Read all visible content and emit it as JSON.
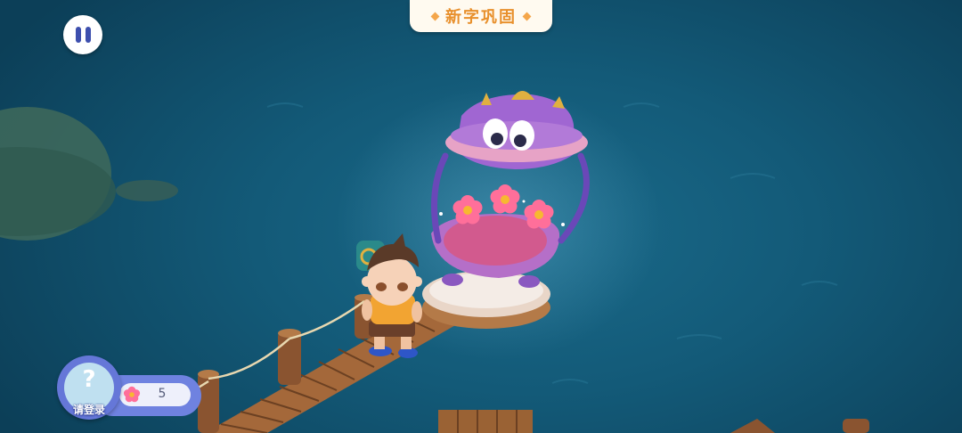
{
  "game": {
    "title": "新字巩固",
    "pause_icon": "pause-icon"
  },
  "hud": {
    "login_label": "请登录",
    "avatar_icon": "question-mark-icon",
    "currency_icon": "flower-icon",
    "flower_count": "5"
  },
  "colors": {
    "title": "#e8902c",
    "hud_accent": "#6f82e0",
    "flower": "#ff6f9a"
  }
}
